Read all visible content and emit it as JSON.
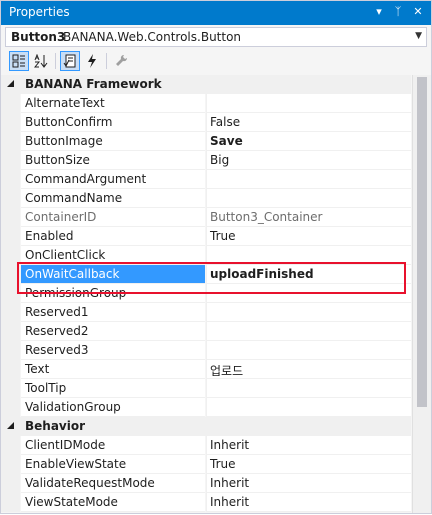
{
  "window": {
    "title": "Properties",
    "controls": {
      "dropdown_glyph": "▾",
      "pin_glyph": "ᛉ",
      "close_glyph": "✕"
    }
  },
  "object_selector": {
    "name": "Button3",
    "type": "BANANA.Web.Controls.Button",
    "dropdown_glyph": "▼"
  },
  "toolbar": {
    "buttons": [
      {
        "name": "categorized-icon",
        "active": true
      },
      {
        "name": "alphabetical-icon",
        "active": false
      },
      {
        "name": "properties-icon",
        "active": true
      },
      {
        "name": "events-icon",
        "active": false
      },
      {
        "name": "property-pages-icon",
        "active": false
      }
    ]
  },
  "grid": {
    "categories": [
      {
        "label": "BANANA Framework",
        "properties": [
          {
            "name": "AlternateText",
            "value": ""
          },
          {
            "name": "ButtonConfirm",
            "value": "False"
          },
          {
            "name": "ButtonImage",
            "value": "Save",
            "bold": true
          },
          {
            "name": "ButtonSize",
            "value": "Big"
          },
          {
            "name": "CommandArgument",
            "value": ""
          },
          {
            "name": "CommandName",
            "value": ""
          },
          {
            "name": "ContainerID",
            "value": "Button3_Container",
            "readonly": true
          },
          {
            "name": "Enabled",
            "value": "True"
          },
          {
            "name": "OnClientClick",
            "value": ""
          },
          {
            "name": "OnWaitCallback",
            "value": "uploadFinished",
            "bold": true,
            "selected": true
          },
          {
            "name": "PermissionGroup",
            "value": ""
          },
          {
            "name": "Reserved1",
            "value": ""
          },
          {
            "name": "Reserved2",
            "value": ""
          },
          {
            "name": "Reserved3",
            "value": ""
          },
          {
            "name": "Text",
            "value": "업로드"
          },
          {
            "name": "ToolTip",
            "value": ""
          },
          {
            "name": "ValidationGroup",
            "value": ""
          }
        ]
      },
      {
        "label": "Behavior",
        "properties": [
          {
            "name": "ClientIDMode",
            "value": "Inherit"
          },
          {
            "name": "EnableViewState",
            "value": "True"
          },
          {
            "name": "ValidateRequestMode",
            "value": "Inherit"
          },
          {
            "name": "ViewStateMode",
            "value": "Inherit"
          }
        ]
      }
    ]
  },
  "colors": {
    "title_bar": "#007acc",
    "selection": "#3399ff",
    "highlight_frame": "#e8112d"
  }
}
